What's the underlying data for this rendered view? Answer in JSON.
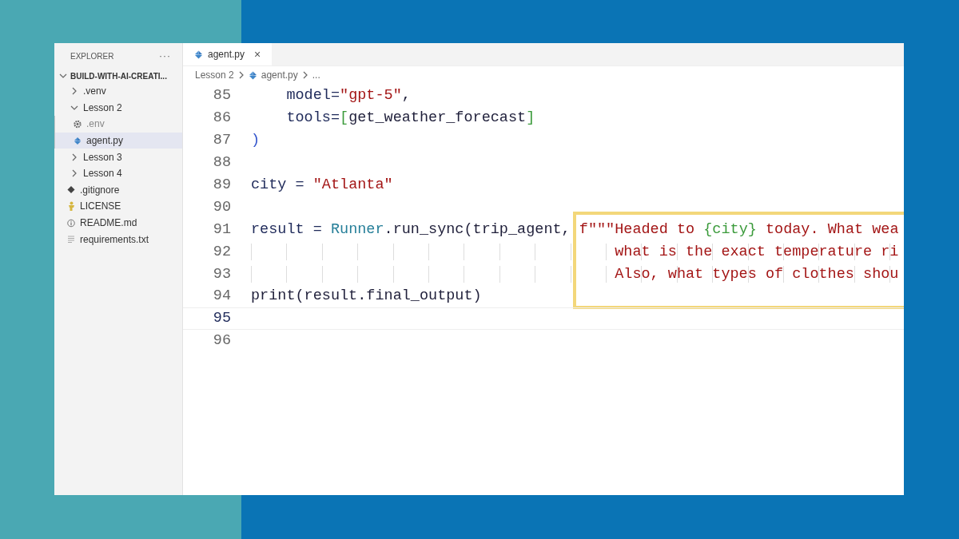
{
  "explorer": {
    "title": "EXPLORER",
    "more": "···",
    "root": {
      "label": "BUILD-WITH-AI-CREATI...",
      "expanded": true,
      "children": [
        {
          "label": ".venv",
          "kind": "folder",
          "expanded": false,
          "selected": false
        },
        {
          "label": "Lesson 2",
          "kind": "folder",
          "expanded": true,
          "selected": false,
          "children": [
            {
              "label": ".env",
              "kind": "env",
              "selected": false
            },
            {
              "label": "agent.py",
              "kind": "python",
              "selected": true
            }
          ]
        },
        {
          "label": "Lesson 3",
          "kind": "folder",
          "expanded": false,
          "selected": false
        },
        {
          "label": "Lesson 4",
          "kind": "folder",
          "expanded": false,
          "selected": false
        },
        {
          "label": ".gitignore",
          "kind": "git",
          "selected": false
        },
        {
          "label": "LICENSE",
          "kind": "license",
          "selected": false
        },
        {
          "label": "README.md",
          "kind": "readme",
          "selected": false
        },
        {
          "label": "requirements.txt",
          "kind": "text",
          "selected": false
        }
      ]
    }
  },
  "tabs": [
    {
      "label": "agent.py",
      "close": "×",
      "selected": true
    }
  ],
  "breadcrumb": {
    "folder": "Lesson 2",
    "file": "agent.py",
    "more": "..."
  },
  "editor": {
    "lines": [
      {
        "number": "85",
        "current": false,
        "guides": false,
        "tokens": [
          {
            "text": "    model=",
            "kind": "name"
          },
          {
            "text": "\"gpt-5\"",
            "kind": "string"
          },
          {
            "text": ",",
            "kind": "plain"
          }
        ]
      },
      {
        "number": "86",
        "current": false,
        "guides": false,
        "tokens": [
          {
            "text": "    tools=",
            "kind": "name"
          },
          {
            "text": "[",
            "kind": "bracket"
          },
          {
            "text": "get_weather_forecast",
            "kind": "plain"
          },
          {
            "text": "]",
            "kind": "bracket"
          }
        ]
      },
      {
        "number": "87",
        "current": false,
        "guides": false,
        "tokens": [
          {
            "text": ")",
            "kind": "paren"
          }
        ]
      },
      {
        "number": "88",
        "current": false
      },
      {
        "number": "89",
        "current": false,
        "guides": false,
        "tokens": [
          {
            "text": "city = ",
            "kind": "name"
          },
          {
            "text": "\"Atlanta\"",
            "kind": "string"
          }
        ]
      },
      {
        "number": "90",
        "current": false
      },
      {
        "number": "91",
        "current": false,
        "guides": false,
        "tokens": [
          {
            "text": "result = ",
            "kind": "name"
          },
          {
            "text": "Runner",
            "kind": "class"
          },
          {
            "text": ".run_sync(trip_agent, ",
            "kind": "plain"
          },
          {
            "text": "f",
            "kind": "string"
          },
          {
            "text": "\"\"\"Headed to ",
            "kind": "string"
          },
          {
            "text": "{city}",
            "kind": "bracket"
          },
          {
            "text": " today. What wea",
            "kind": "string"
          }
        ]
      },
      {
        "number": "92",
        "current": false,
        "guides": true,
        "tokens": [
          {
            "text": "                                         what is the exact temperature ri",
            "kind": "string"
          }
        ]
      },
      {
        "number": "93",
        "current": false,
        "guides": true,
        "tokens": [
          {
            "text": "                                         Also, what types of clothes shou",
            "kind": "string"
          }
        ]
      },
      {
        "number": "94",
        "current": false,
        "guides": false,
        "tokens": [
          {
            "text": "print(result.final_output)",
            "kind": "plain"
          }
        ]
      },
      {
        "number": "95",
        "current": true
      },
      {
        "number": "96",
        "current": false
      }
    ]
  }
}
